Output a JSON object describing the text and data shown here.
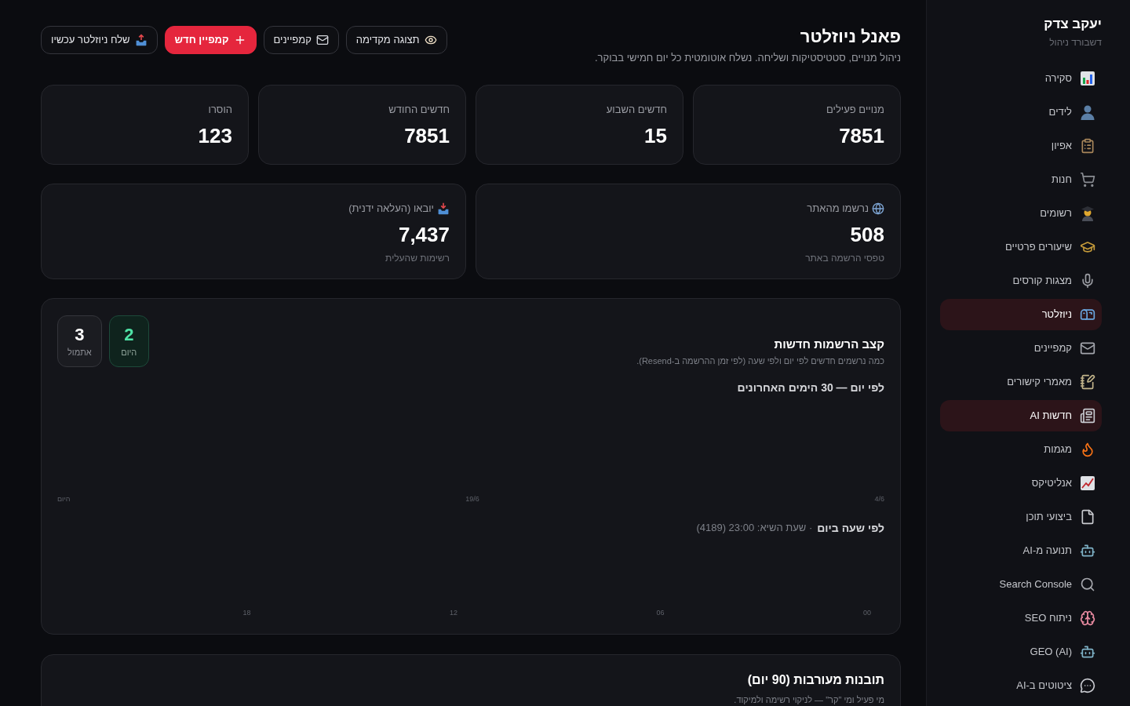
{
  "sidebar": {
    "title": "יעקב צדק",
    "subtitle": "דשבורד ניהול",
    "items": [
      {
        "label": "סקירה",
        "selected": false
      },
      {
        "label": "לידים",
        "selected": false
      },
      {
        "label": "אפיון",
        "selected": false
      },
      {
        "label": "חנות",
        "selected": false
      },
      {
        "label": "רשומים",
        "selected": false
      },
      {
        "label": "שיעורים פרטיים",
        "selected": false
      },
      {
        "label": "מצגות קורסים",
        "selected": false
      },
      {
        "label": "ניוזלטר",
        "selected": true
      },
      {
        "label": "קמפיינים",
        "selected": false
      },
      {
        "label": "מאמרי קישורים",
        "selected": false
      },
      {
        "label": "חדשות AI",
        "selected": true
      },
      {
        "label": "מגמות",
        "selected": false
      },
      {
        "label": "אנליטיקס",
        "selected": false
      },
      {
        "label": "ביצועי תוכן",
        "selected": false
      },
      {
        "label": "תנועה מ-AI",
        "selected": false
      },
      {
        "label": "Search Console",
        "selected": false
      },
      {
        "label": "ניתוח SEO",
        "selected": false
      },
      {
        "label": "GEO (AI)",
        "selected": false
      },
      {
        "label": "ציטוטים ב-AI",
        "selected": false
      }
    ]
  },
  "header": {
    "title": "פאנל ניוזלטר",
    "subtitle": "ניהול מנויים, סטטיסטיקות ושליחה. נשלח אוטומטית כל יום חמישי בבוקר.",
    "buttons": [
      {
        "label": "תצוגה מקדימה",
        "kind": "outline"
      },
      {
        "label": "קמפיינים",
        "kind": "outline"
      },
      {
        "label": "קמפיין חדש",
        "kind": "primary"
      },
      {
        "label": "שלח ניוזלטר עכשיו",
        "kind": "outline"
      }
    ]
  },
  "stats": [
    {
      "label": "מנויים פעילים",
      "value": "7851"
    },
    {
      "label": "חדשים השבוע",
      "value": "15"
    },
    {
      "label": "חדשים החודש",
      "value": "7851"
    },
    {
      "label": "הוסרו",
      "value": "123"
    }
  ],
  "sources": [
    {
      "label": "נרשמו מהאתר",
      "value": "508",
      "note": "טפסי הרשמה באתר"
    },
    {
      "label": "יובאו (העלאה ידנית)",
      "value": "7,437",
      "note": "רשימות שהעלית"
    }
  ],
  "signups": {
    "title": "קצב הרשמות חדשות",
    "subtitle": "כמה נרשמים חדשים לפי יום ולפי שעה (לפי זמן ההרשמה ב-Resend).",
    "tiles": [
      {
        "value": "2",
        "label": "היום",
        "kind": "highlight"
      },
      {
        "value": "3",
        "label": "אתמול",
        "kind": "neutral"
      }
    ],
    "daily": {
      "title": "לפי יום — 30 הימים האחרונים",
      "axis_labels": [
        "4/6",
        "19/6",
        "היום"
      ]
    },
    "hourly": {
      "title": "לפי שעה ביום",
      "peak": "· שעת השיא: 23:00 (4189)",
      "axis_labels": [
        "00",
        "06",
        "12",
        "18"
      ]
    }
  },
  "engagement": {
    "title": "תובנות מעורבות (90 יום)",
    "subtitle": "מי פעיל ומי \"קר\" — לניקוי רשימה ולמיקוד."
  }
}
